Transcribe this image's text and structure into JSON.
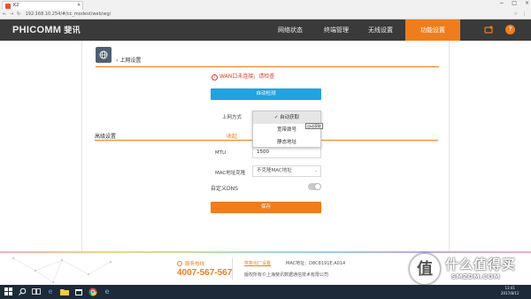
{
  "browser": {
    "tab_title": "K2",
    "tab_close": "×",
    "window_controls": [
      "−",
      "□",
      "×"
    ],
    "address": "192.168.10.254/#/cc_modest/web/wg/",
    "icons": [
      "back-icon",
      "forward-icon",
      "reload-icon",
      "star-icon",
      "menu-icon"
    ]
  },
  "nav": {
    "logo": "PHICOMM",
    "logo_cn": "斐讯",
    "items": [
      {
        "label": "网络状态",
        "active": false
      },
      {
        "label": "终端管理",
        "active": false
      },
      {
        "label": "无线设置",
        "active": false
      },
      {
        "label": "功能设置",
        "active": true
      }
    ],
    "icons": [
      "upgrade-icon",
      "help-icon"
    ],
    "help_glyph": "?"
  },
  "page": {
    "back_icon": "globe-back-icon",
    "title": "上网设置",
    "warning": "WAN口未连接，请检查",
    "auto_detect_button": "自动检测",
    "connection_mode_label": "上网方式",
    "connection_mode_options": [
      {
        "label": "✓ 自动获取",
        "selected": true
      },
      {
        "label": "宽带拨号",
        "selected": false
      },
      {
        "label": "静态地址",
        "selected": false
      }
    ],
    "tooltip": "自动获取",
    "advanced_label": "高级设置",
    "collapse_link": "收起",
    "mtu_label": "MTU",
    "mtu_value": "1500",
    "mac_clone_label": "MAC地址克隆",
    "mac_clone_value": "不克隆MAC地址",
    "custom_dns_label": "自定义DNS",
    "custom_dns_enabled": false,
    "save_button": "保存"
  },
  "footer": {
    "service_label": "服务热线",
    "phone": "4007-567-567",
    "restore_link": "恢复出厂设置",
    "mac_address": "MAC地址：D8C8191E:A014",
    "copyright": "版权所有©上海斐讯数据通信技术有限公司"
  },
  "watermark": {
    "text_main": "什么值得买",
    "text_sub": "SMZDM.COM"
  },
  "taskbar": {
    "icons": [
      "windows-start-icon",
      "search-icon",
      "task-view-icon",
      "edge-icon",
      "file-explorer-icon",
      "store-icon",
      "chrome-icon",
      "ie-icon"
    ],
    "time": "13:41",
    "date": "2017/8/12"
  },
  "colors": {
    "accent": "#ef7d1c",
    "button_blue": "#20a3e0",
    "nav_bg": "#3a3a3a",
    "warning": "#e43b2f"
  }
}
